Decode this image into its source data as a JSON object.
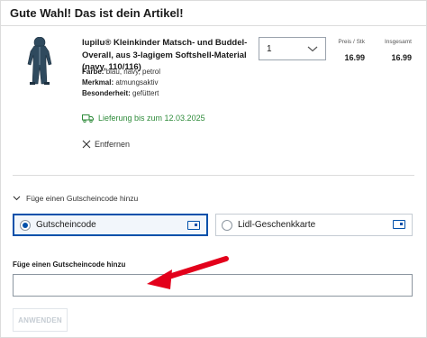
{
  "header": {
    "title": "Gute Wahl! Das ist dein Artikel!"
  },
  "product": {
    "name": "lupilu® Kleinkinder Matsch- und Buddel-Overall, aus 3-lagigem Softshell-Material (navy, 110/116)",
    "attributes": [
      {
        "label": "Farbe:",
        "value": "blau, navy, petrol"
      },
      {
        "label": "Merkmal:",
        "value": "atmungsaktiv"
      },
      {
        "label": "Besonderheit:",
        "value": "gefüttert"
      }
    ],
    "delivery": "Lieferung bis zum 12.03.2025",
    "remove_label": "Entfernen",
    "quantity": "1",
    "price_header": "Preis / Stk",
    "total_header": "Insgesamt",
    "unit_price": "16.99",
    "total_price": "16.99"
  },
  "coupon": {
    "toggle_label": "Füge einen Gutscheincode hinzu",
    "options": [
      {
        "label": "Gutscheincode",
        "selected": true
      },
      {
        "label": "Lidl-Geschenkkarte",
        "selected": false
      }
    ],
    "field_label": "Füge einen Gutscheincode hinzu",
    "input_value": "",
    "apply_label": "ANWENDEN"
  },
  "colors": {
    "accent": "#0050aa",
    "delivery_green": "#2e8b3a",
    "annotation_arrow": "#e3001b",
    "product_navy": "#2f4a5e"
  },
  "icons": [
    "overall-product-image",
    "chevron-down-icon",
    "truck-icon",
    "close-icon",
    "card-icon",
    "red-arrow-annotation"
  ]
}
